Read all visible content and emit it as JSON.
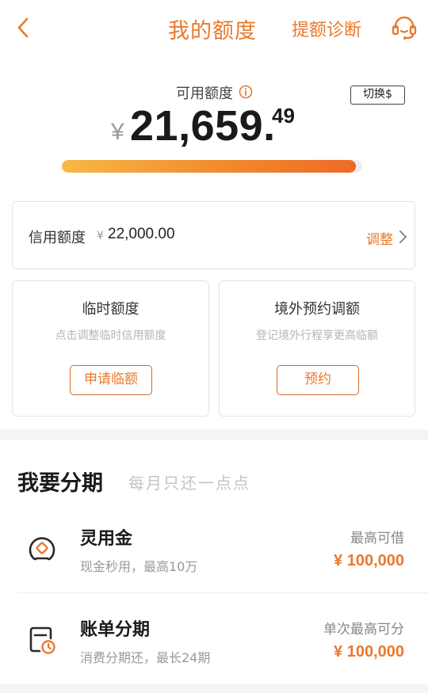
{
  "header": {
    "title": "我的额度",
    "diagnose_label": "提额诊断"
  },
  "available": {
    "label": "可用额度",
    "switch_label": "切换$",
    "currency_symbol": "¥",
    "amount_integer": "21,659.",
    "amount_decimal": "49",
    "usage_fraction": 0.98
  },
  "credit": {
    "label": "信用额度",
    "currency_symbol": "¥",
    "value": "22,000.00",
    "adjust_label": "调整"
  },
  "temp_card": {
    "title": "临时额度",
    "subtitle": "点击调整临时信用额度",
    "button_label": "申请临额"
  },
  "abroad_card": {
    "title": "境外预约调额",
    "subtitle": "登记境外行程享更高临额",
    "button_label": "预约"
  },
  "installment": {
    "title": "我要分期",
    "subtitle": "每月只还一点点",
    "items": [
      {
        "icon": "cash-loan-icon",
        "title": "灵用金",
        "subtitle": "现金秒用，最高10万",
        "right_label": "最高可借",
        "right_value": "¥ 100,000"
      },
      {
        "icon": "bill-installment-icon",
        "title": "账单分期",
        "subtitle": "消费分期还，最长24期",
        "right_label": "单次最高可分",
        "right_value": "¥ 100,000"
      }
    ]
  },
  "colors": {
    "accent": "#e8792e",
    "progress_start": "#f7b846",
    "progress_end": "#ee6a26"
  }
}
